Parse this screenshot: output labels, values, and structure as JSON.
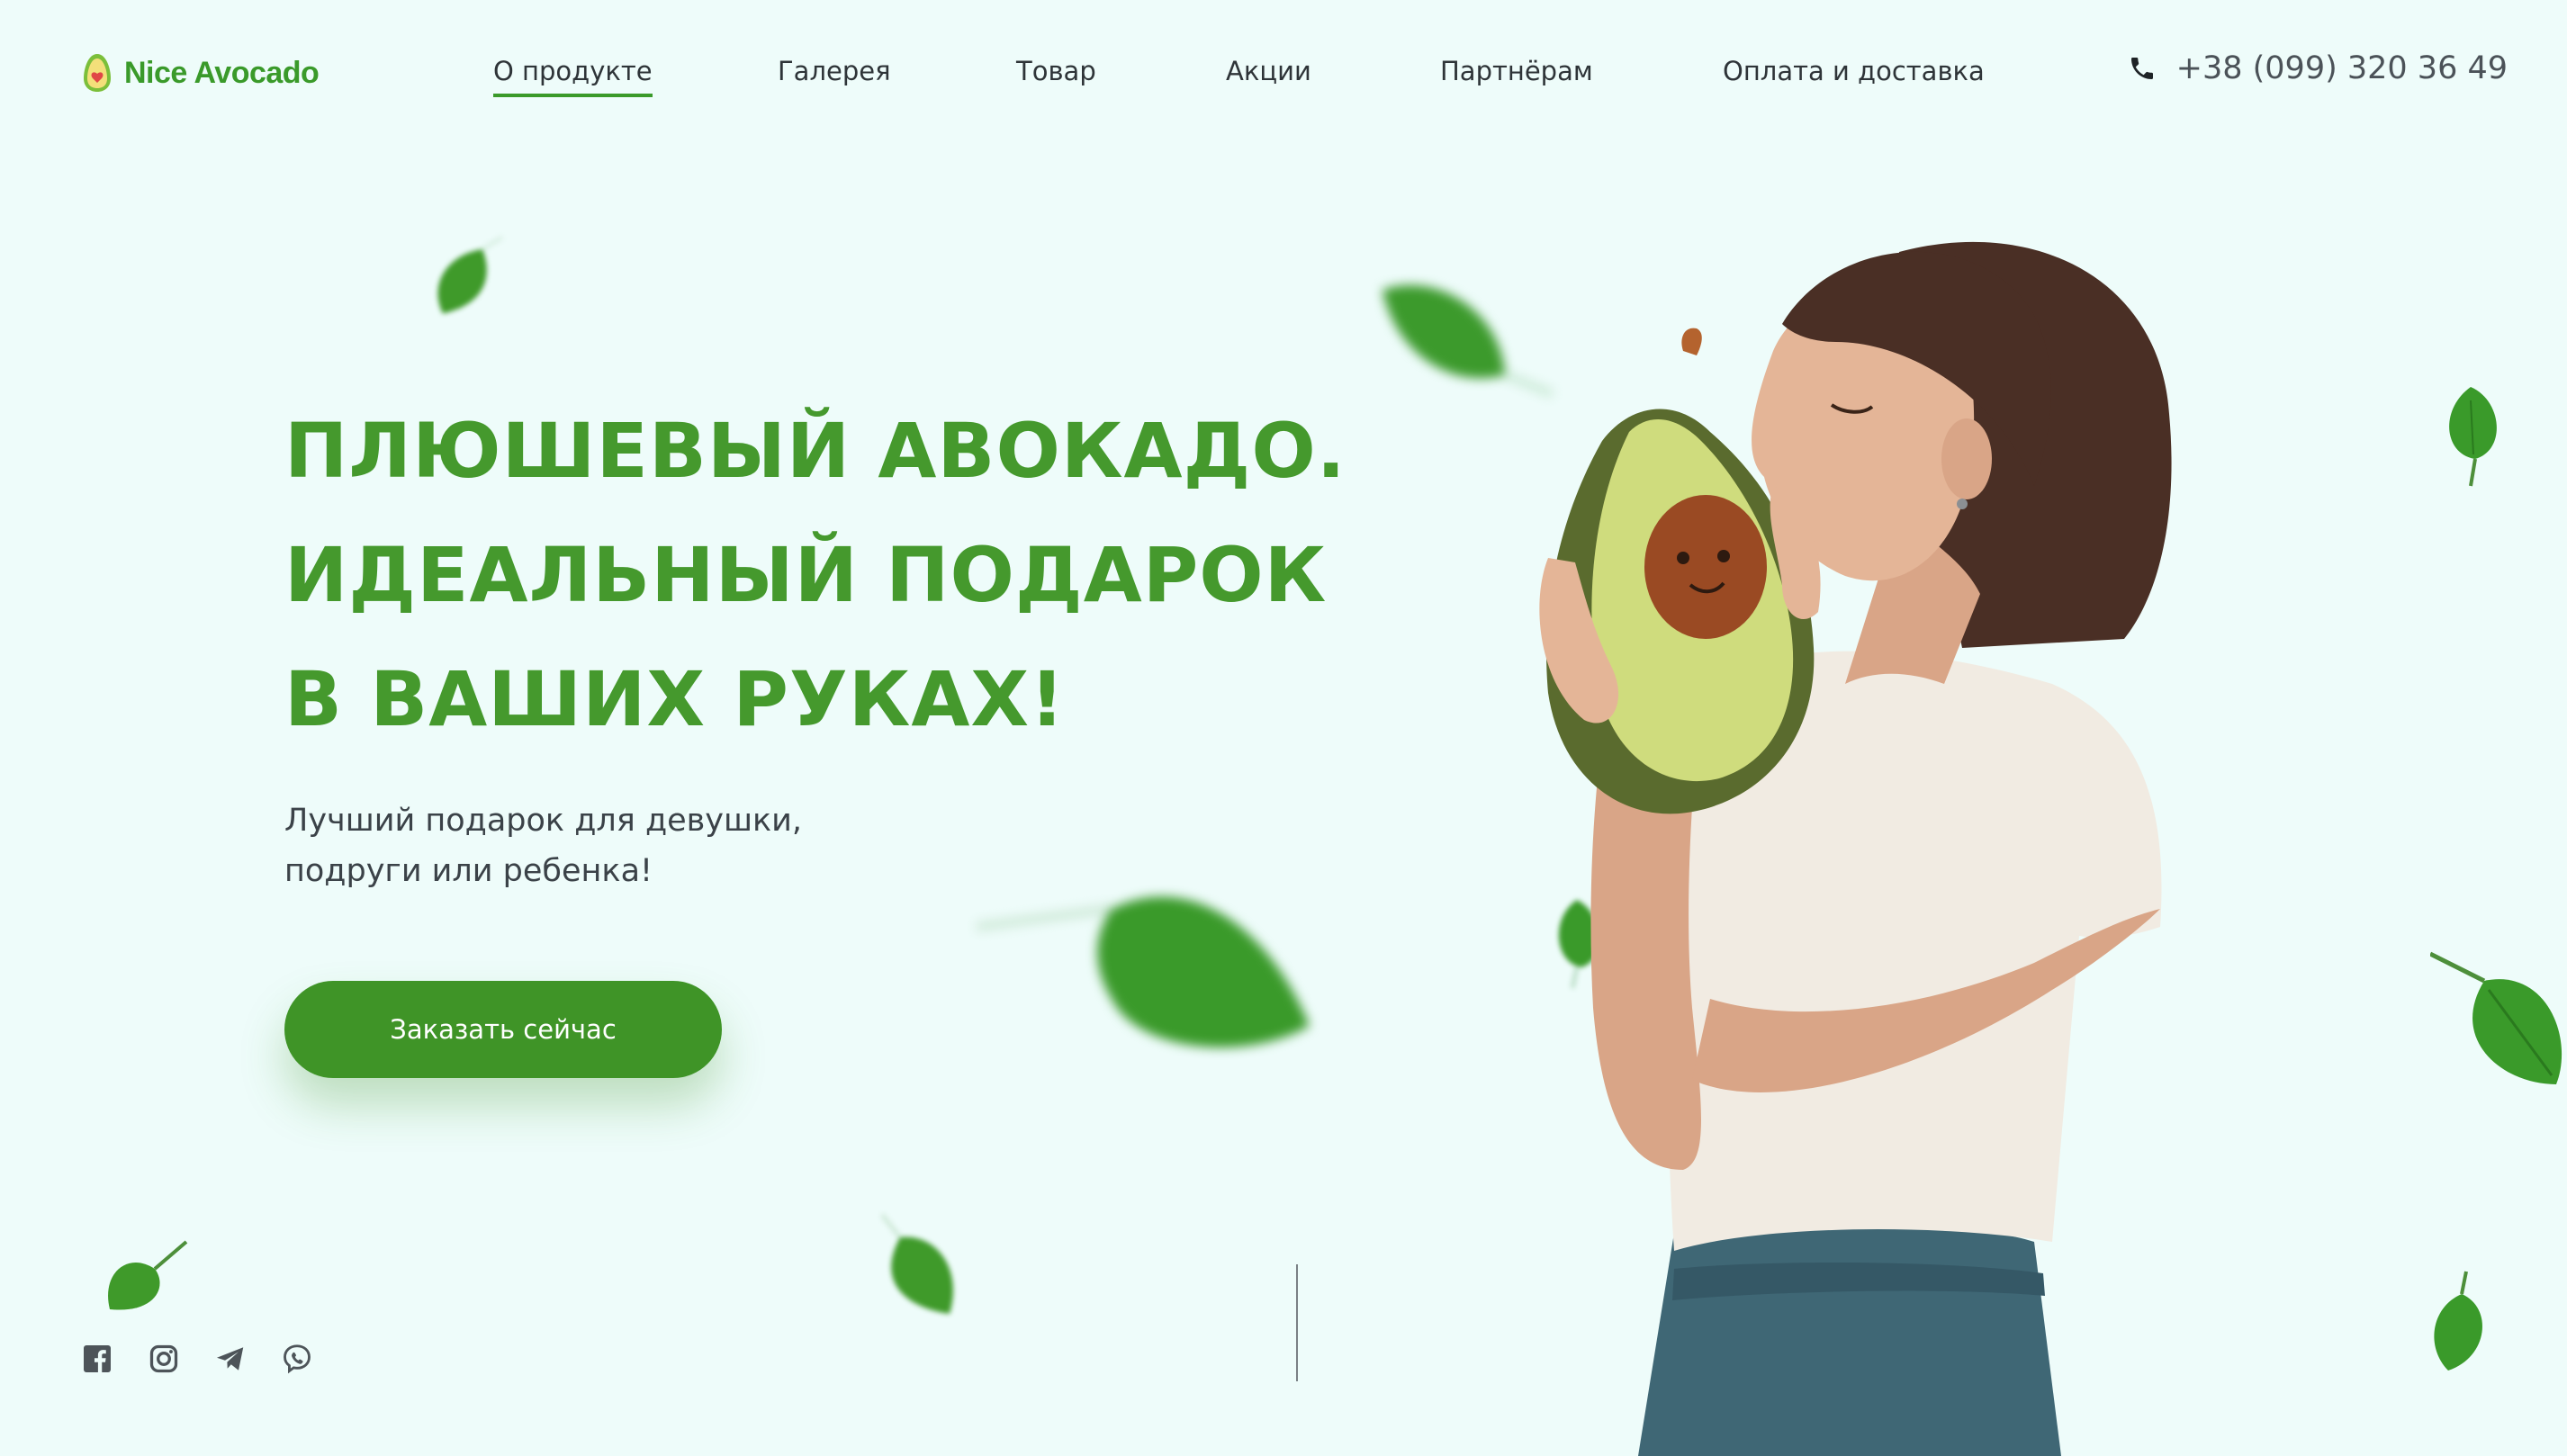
{
  "header": {
    "logo_text": "Nice Avocado",
    "nav": [
      {
        "label": "О продукте",
        "active": true
      },
      {
        "label": "Галерея",
        "active": false
      },
      {
        "label": "Товар",
        "active": false
      },
      {
        "label": "Акции",
        "active": false
      },
      {
        "label": "Партнёрам",
        "active": false
      },
      {
        "label": "Оплата и доставка",
        "active": false
      }
    ],
    "phone": "+38 (099) 320 36 49"
  },
  "hero": {
    "title_lines": [
      "ПЛЮШЕВЫЙ АВОКАДО.",
      "ИДЕАЛЬНЫЙ ПОДАРОК",
      "В ВАШИХ РУКАХ!"
    ],
    "subtitle_lines": [
      "Лучший подарок для девушки,",
      "подруги или ребенка!"
    ],
    "cta_label": "Заказать сейчас"
  },
  "social": [
    "facebook-icon",
    "instagram-icon",
    "telegram-icon",
    "viber-icon"
  ],
  "colors": {
    "background": "#eefcfa",
    "brand_green": "#3f9427",
    "title_green": "#45992d"
  }
}
